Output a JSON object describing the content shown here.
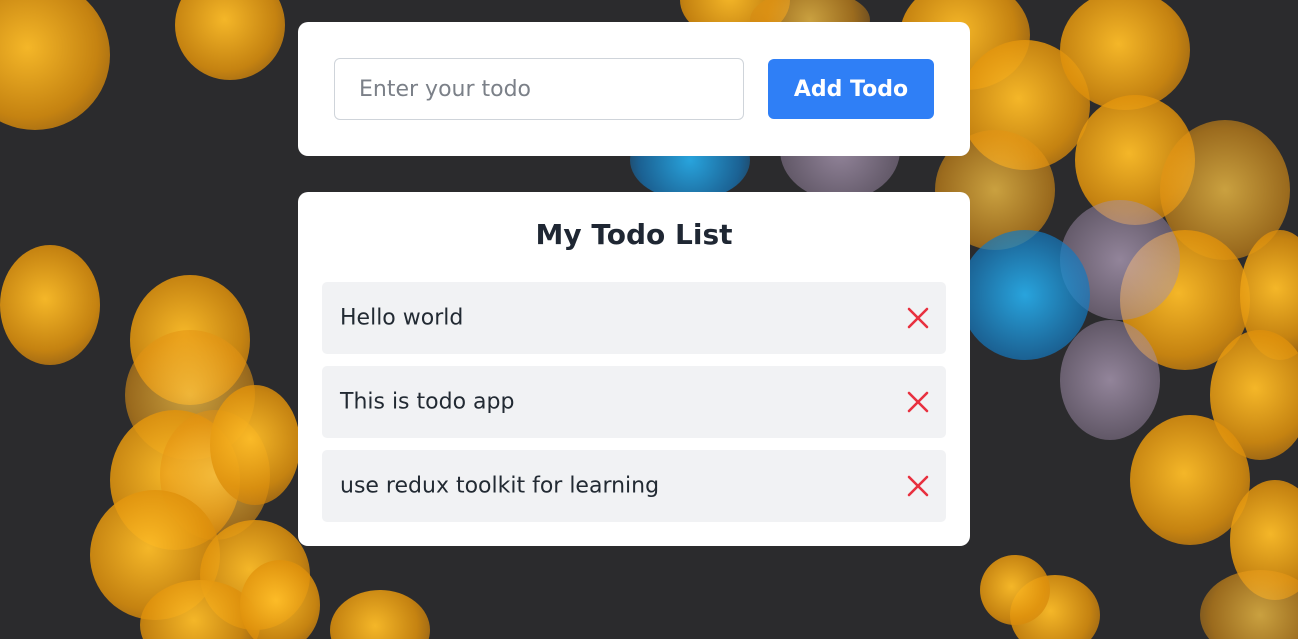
{
  "input_section": {
    "placeholder": "Enter your todo",
    "value": "",
    "add_button_label": "Add Todo"
  },
  "list_section": {
    "title": "My Todo List",
    "items": [
      {
        "text": "Hello world",
        "delete_icon": "close-icon"
      },
      {
        "text": "This is todo app",
        "delete_icon": "close-icon"
      },
      {
        "text": "use redux toolkit for learning",
        "delete_icon": "close-icon"
      }
    ]
  },
  "colors": {
    "primary": "#2f7ff6",
    "delete": "#e8303f",
    "item_background": "#f1f2f4",
    "card_background": "#ffffff"
  }
}
